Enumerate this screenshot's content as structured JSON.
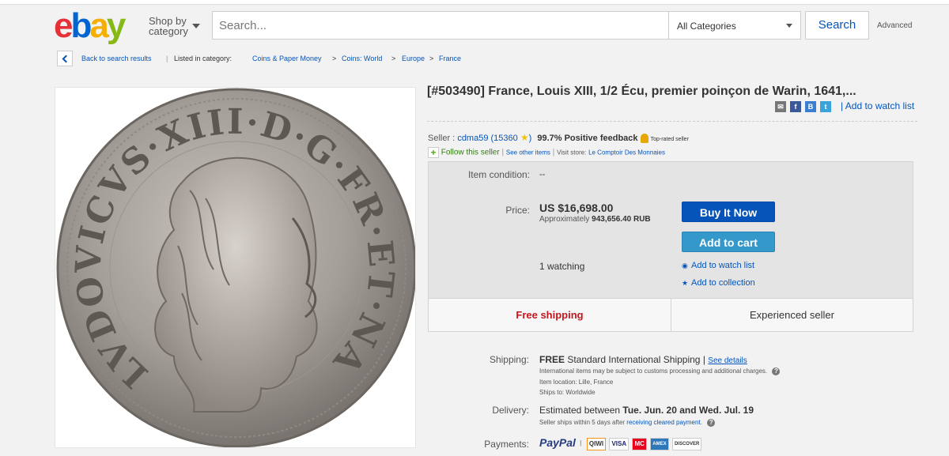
{
  "header": {
    "logo_letters": [
      "e",
      "b",
      "a",
      "y"
    ],
    "logo_colors": [
      "#e53238",
      "#0064d2",
      "#f5af02",
      "#86b817"
    ],
    "shop_by_line1": "Shop by",
    "shop_by_line2": "category",
    "search_placeholder": "Search...",
    "category_selected": "All Categories",
    "search_button": "Search",
    "advanced_link": "Advanced"
  },
  "breadcrumb": {
    "back_label": "Back to search results",
    "listed_label": "Listed in category:",
    "items": [
      "Coins & Paper Money",
      "Coins: World",
      "Europe",
      "France"
    ],
    "separator": ">"
  },
  "listing": {
    "title": "[#503490] France, Louis XIII, 1/2 Écu, premier poinçon de Warin, 1641,...",
    "share_icons": [
      "email-icon",
      "facebook-icon",
      "blogger-icon",
      "twitter-icon"
    ],
    "watch_link": "| Add to watch list",
    "seller_label": "Seller :",
    "seller_name": "cdma59",
    "seller_score": "(15360",
    "seller_score_close": ")",
    "positive_feedback": "99.7% Positive feedback",
    "top_rated": "Top-rated seller",
    "follow_seller": "Follow this seller",
    "see_other_items": "See other items",
    "visit_store_label": "Visit store:",
    "store_name": "Le Comptoir Des Monnaies"
  },
  "purchase": {
    "condition_label": "Item condition:",
    "condition_value": "--",
    "price_label": "Price:",
    "price": "US $16,698.00",
    "approx_label": "Approximately",
    "approx_value": "943,656.40 RUB",
    "buy_now": "Buy It Now",
    "add_to_cart": "Add to cart",
    "watching": "1 watching",
    "add_watch": "Add to watch list",
    "add_collection": "Add to collection",
    "free_shipping": "Free shipping",
    "experienced_seller": "Experienced seller"
  },
  "shipping": {
    "shipping_label": "Shipping:",
    "shipping_free": "FREE",
    "shipping_method": "Standard International Shipping |",
    "see_details": "See details",
    "customs_note": "International items may be subject to customs processing and additional charges.",
    "item_location": "Item location:  Lille, France",
    "ships_to": "Ships to:  Worldwide",
    "delivery_label": "Delivery:",
    "delivery_prefix": "Estimated between",
    "delivery_dates": "Tue. Jun. 20 and Wed. Jul. 19",
    "ships_within": "Seller ships within 5 days after",
    "receiving_cleared": "receiving cleared payment",
    "payments_label": "Payments:",
    "paypal": "PayPal",
    "card_logos": [
      "QIWI",
      "VISA",
      "MC",
      "AMEX",
      "DISCOVER"
    ]
  },
  "coin": {
    "legend": "LVDOVICVS·XIII·D·G·FR·ET·NAV·REX"
  }
}
